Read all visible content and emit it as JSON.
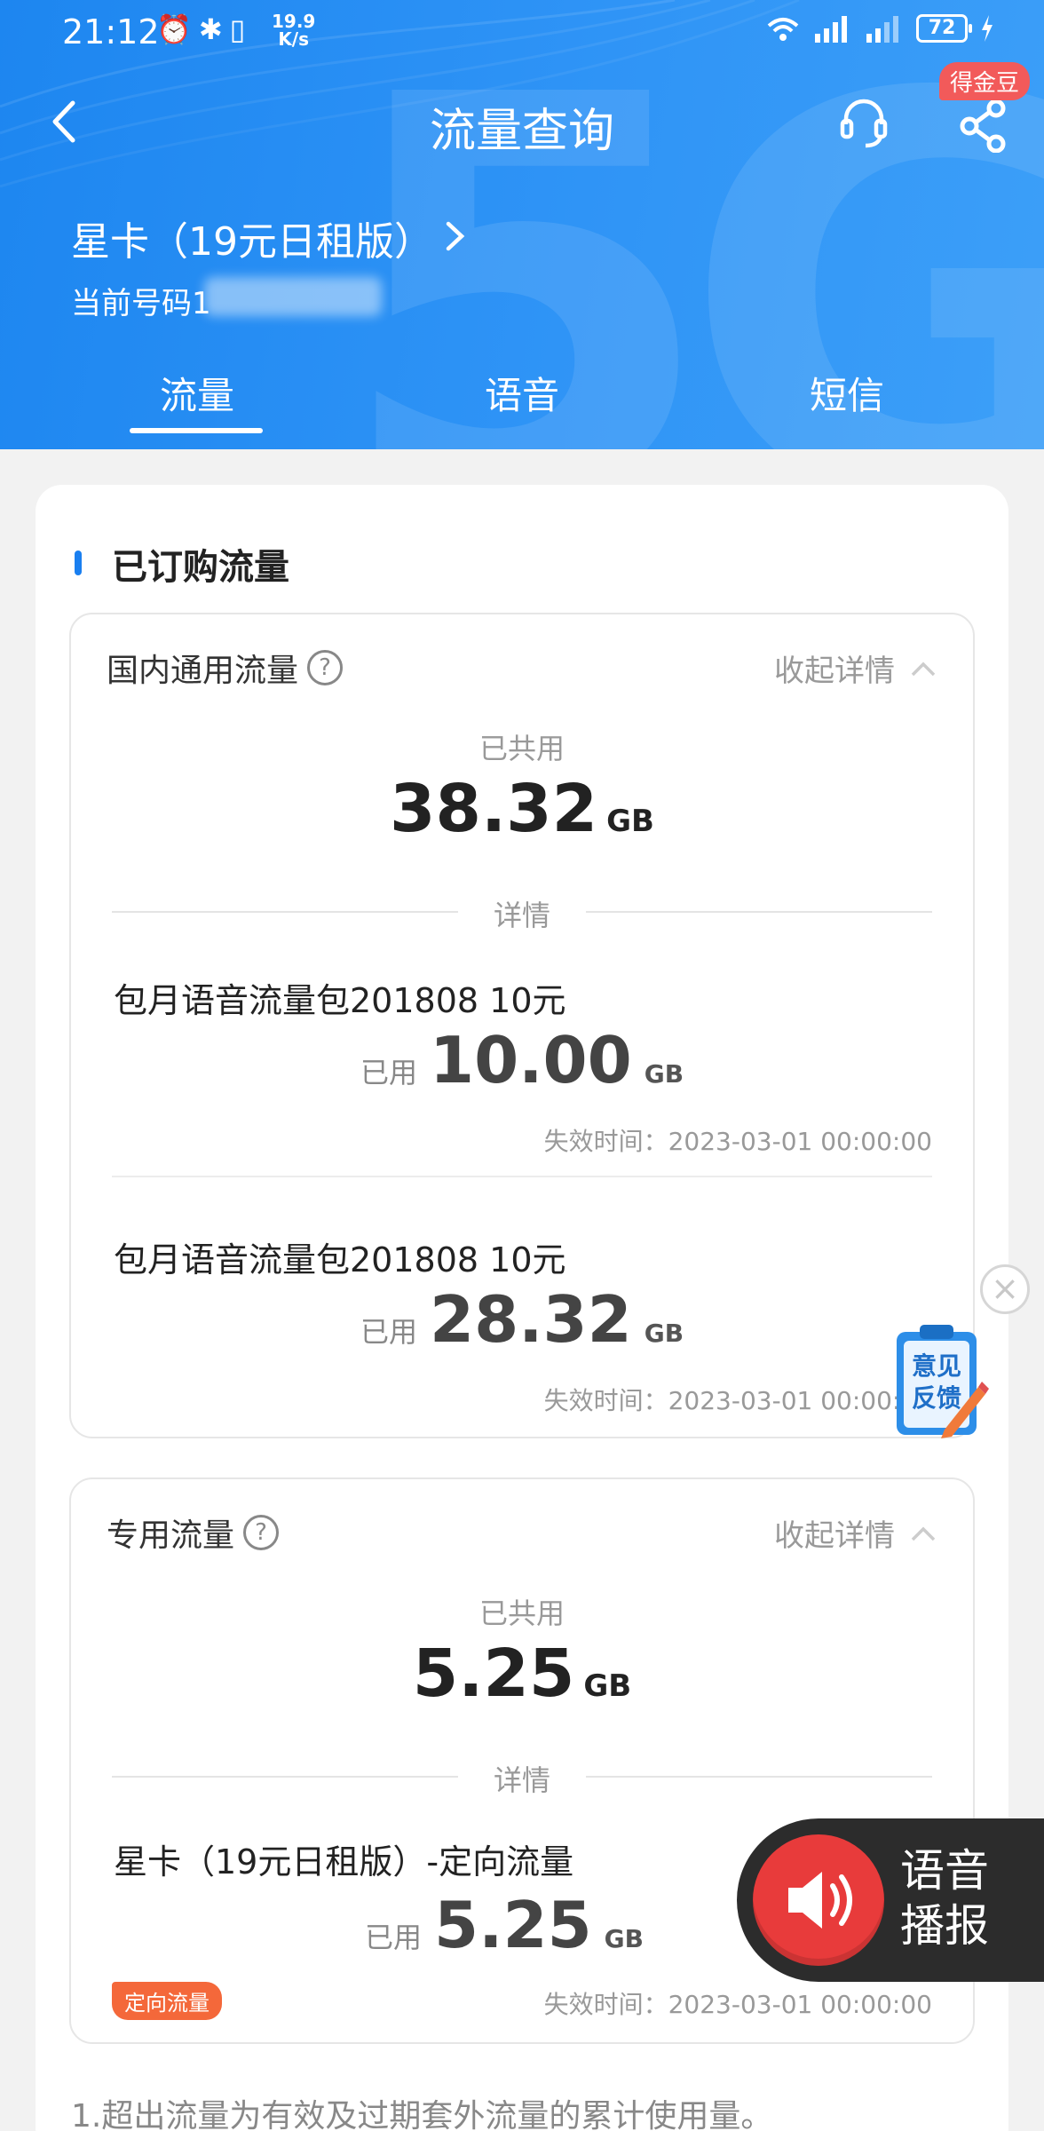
{
  "status_bar": {
    "time": "21:12",
    "speed_value": "19.9",
    "speed_unit": "K/s",
    "battery": "72"
  },
  "header": {
    "title": "流量查询",
    "badge": "得金豆",
    "plan_name": "星卡（19元日租版）",
    "current_number_label": "当前号码1"
  },
  "tabs": [
    "流量",
    "语音",
    "短信"
  ],
  "section_title": "已订购流量",
  "domestic": {
    "label": "国内通用流量",
    "collapse_label": "收起详情",
    "shared_label": "已共用",
    "shared_value": "38.32",
    "unit": "GB",
    "details_label": "详情",
    "items": [
      {
        "name": "包月语音流量包201808  10元",
        "used_prefix": "已用",
        "used": "10.00",
        "unit": "GB",
        "expire": "失效时间：2023-03-01 00:00:00"
      },
      {
        "name": "包月语音流量包201808  10元",
        "used_prefix": "已用",
        "used": "28.32",
        "unit": "GB",
        "expire": "失效时间：2023-03-01 00:00:00"
      }
    ]
  },
  "dedicated": {
    "label": "专用流量",
    "collapse_label": "收起详情",
    "shared_label": "已共用",
    "shared_value": "5.25",
    "unit": "GB",
    "details_label": "详情",
    "items": [
      {
        "name": "星卡（19元日租版）-定向流量",
        "used_prefix": "已用",
        "used": "5.25",
        "unit": "GB",
        "tag": "定向流量",
        "expire": "失效时间：2023-03-01 00:00:00"
      }
    ]
  },
  "note": "1.超出流量为有效及过期套外流量的累计使用量。",
  "feedback": {
    "line1": "意见",
    "line2": "反馈"
  },
  "voice_broadcast": {
    "line1": "语音",
    "line2": "播报"
  },
  "colors": {
    "header_blue": "#2a8ff4",
    "accent_blue": "#1a7ff0",
    "tag_orange": "#f4683a",
    "voice_red": "#e83b3b",
    "badge_red": "#f25a5a"
  }
}
